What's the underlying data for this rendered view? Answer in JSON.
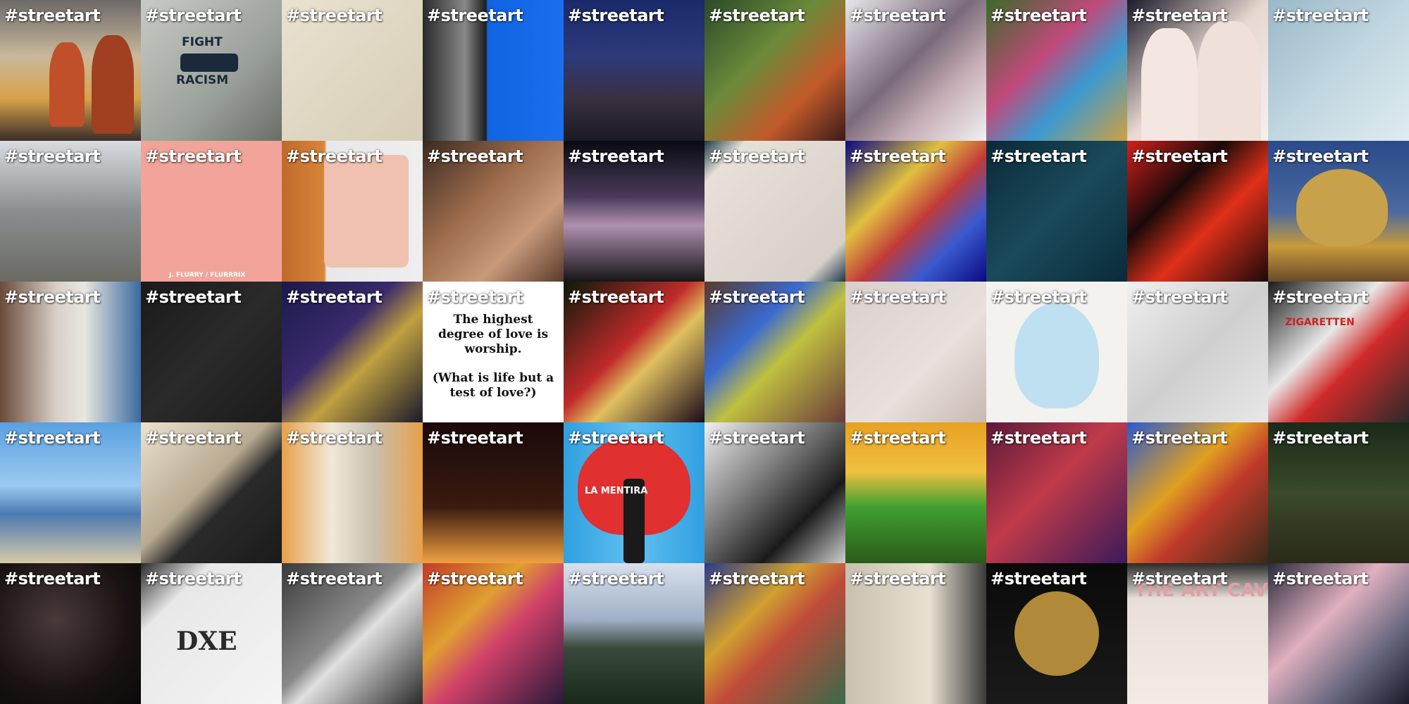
{
  "hashtag": "#streetart",
  "tiles": [
    {
      "subject": "luchador-mural",
      "bg": "linear-gradient(180deg,#6d6a6a 0%,#c9b89a 40%,#d8a24a 70%,#3a2e2a 100%)"
    },
    {
      "subject": "fight-racism-poster",
      "bg": "linear-gradient(135deg,#c8cbc4 0%,#9aa09a 60%,#6a6e68 100%)",
      "line1": "FIGHT",
      "line2": "RACISM"
    },
    {
      "subject": "ink-drawing",
      "bg": "linear-gradient(135deg,#e9e2d0 0%,#d7cdb6 100%)"
    },
    {
      "subject": "blue-sky-wall",
      "bg": "linear-gradient(90deg,#2a2a2a 0%,#888 30%,#1c1c1c 45%,#1064e0 46%,#1a6ff0 100%)"
    },
    {
      "subject": "night-street",
      "bg": "linear-gradient(180deg,#1a2a6a 0%,#2c3a7a 40%,#3a3040 70%,#1a1a22 100%)"
    },
    {
      "subject": "face-mural-green",
      "bg": "linear-gradient(135deg,#2a4a2a 0%,#6b8a3a 40%,#c25a2a 70%,#3a1a1a 100%)"
    },
    {
      "subject": "abstract-figures",
      "bg": "linear-gradient(135deg,#e8e6ec 0%,#7a6a7a 45%,#c8b0b8 70%,#f0f0f0 100%)"
    },
    {
      "subject": "colorful-face-mural",
      "bg": "linear-gradient(135deg,#3a6a2a 0%,#c04a7a 40%,#3a9ad0 65%,#d0a040 100%)"
    },
    {
      "subject": "two-girls",
      "bg": "linear-gradient(135deg,#1a1a2a 0%,#e8d8d0 50%,#f6f0f0 100%)"
    },
    {
      "subject": "heart-sketch",
      "bg": "linear-gradient(135deg,#9ab8c8 0%,#c0d6e0 50%,#e0ecf0 100%)"
    },
    {
      "subject": "city-street",
      "bg": "linear-gradient(180deg,#d8dce0 0%,#8a8e90 50%,#6a6a62 100%)"
    },
    {
      "subject": "pink-tape-art",
      "bg": "#f2a49a",
      "credit": "J. FLURRY / FLURRRIX"
    },
    {
      "subject": "frida-poster",
      "bg": "linear-gradient(90deg,#c06a2a 0%,#d8843a 30%,#e8e8ea 32%,#eeeeee 100%)"
    },
    {
      "subject": "kiss-mural",
      "bg": "linear-gradient(135deg,#3a2a22 0%,#9a6a4a 40%,#c89a7a 70%,#5a3a2a 100%)"
    },
    {
      "subject": "giant-poster-night",
      "bg": "linear-gradient(180deg,#0a0a12 0%,#4a3a5a 40%,#b090b0 60%,#151515 100%)"
    },
    {
      "subject": "ink-splatter-canvas",
      "bg": "linear-gradient(135deg,#1a3a4a 0%,#e6e0d8 15%,#d8d0c8 85%,#1a3a4a 100%)"
    },
    {
      "subject": "cubist-skull",
      "bg": "linear-gradient(135deg,#0a0a80 0%,#e0c040 35%,#c03a3a 55%,#3a5ad0 75%,#0a0a80 100%)"
    },
    {
      "subject": "framed-portraits",
      "bg": "linear-gradient(135deg,#0a2a3a 0%,#1a4a5a 50%,#0a2a3a 100%)"
    },
    {
      "subject": "red-black-graffiti",
      "bg": "linear-gradient(135deg,#d0201a 0%,#1a0a0a 35%,#e0301a 60%,#1a0a0a 100%)"
    },
    {
      "subject": "gold-skull-sculpture",
      "bg": "linear-gradient(180deg,#2a4a8a 0%,#4a6aa0 50%,#c89a3a 75%,#6a4a2a 100%)"
    },
    {
      "subject": "restroom-mural",
      "bg": "linear-gradient(90deg,#6a4a3a 0%,#d8d0c8 40%,#e8e6e0 60%,#3a6aa0 100%)"
    },
    {
      "subject": "skeleton-mural",
      "bg": "linear-gradient(135deg,#1a1a1a 0%,#2a2a2a 50%,#1a1a1a 100%)"
    },
    {
      "subject": "basquiat-wall",
      "bg": "linear-gradient(135deg,#1a1a4a 0%,#3a2a6a 40%,#c0a040 60%,#1a1a2a 100%)"
    },
    {
      "subject": "quote-card",
      "bg": "#ffffff",
      "line1": "The highest degree of love is worship.",
      "line2": "(What is life but a test of love?)"
    },
    {
      "subject": "red-demon-mural",
      "bg": "linear-gradient(135deg,#0a1a0a 0%,#c02a2a 45%,#e0c060 60%,#1a0a1a 100%)"
    },
    {
      "subject": "graffiti-alley",
      "bg": "linear-gradient(135deg,#5a3a2a 0%,#3a6ad0 35%,#c0c040 55%,#6a3a3a 100%)"
    },
    {
      "subject": "woman-drawing-wall",
      "bg": "linear-gradient(135deg,#d8d0cc 0%,#e8e0dc 60%,#c8b8b0 100%)"
    },
    {
      "subject": "blue-monster-cartoon",
      "bg": "#f4f2ee"
    },
    {
      "subject": "kissing-stencil",
      "bg": "linear-gradient(135deg,#f0f0f0 0%,#cfcfcf 50%,#e8e8e8 100%)"
    },
    {
      "subject": "vending-machine",
      "bg": "linear-gradient(135deg,#1a1a1a 0%,#e8e8e8 40%,#d02a2a 60%,#2a2a2a 100%)",
      "sign": "ZIGARETTEN"
    },
    {
      "subject": "beach-man",
      "bg": "linear-gradient(180deg,#5aa0e0 0%,#9acaf0 45%,#4a7ab0 65%,#d8c8a8 100%)"
    },
    {
      "subject": "sketching-artist",
      "bg": "linear-gradient(135deg,#eae2d0 0%,#b8aa90 45%,#2a2a2a 60%,#1a1a1a 100%)"
    },
    {
      "subject": "narrow-alley",
      "bg": "linear-gradient(90deg,#e8a04a 0%,#f0e8d8 35%,#c8c0b0 65%,#e8a04a 100%)"
    },
    {
      "subject": "night-chalk-drawing",
      "bg": "linear-gradient(180deg,#1a0a0a 0%,#3a1a10 60%,#f0a040 100%)"
    },
    {
      "subject": "heart-shutter",
      "bg": "linear-gradient(90deg,#30a0e0 0%,#60c0f0 50%,#30a0e0 100%)",
      "text": "LA MENTIRA"
    },
    {
      "subject": "bw-graffiti-wall",
      "bg": "linear-gradient(135deg,#f0f0f0 0%,#7a7a7a 40%,#1a1a1a 70%,#d0d0d0 100%)"
    },
    {
      "subject": "green-van",
      "bg": "linear-gradient(180deg,#e8a020 0%,#f0c040 35%,#40a030 60%,#2a5a1a 100%)"
    },
    {
      "subject": "neon-bar",
      "bg": "linear-gradient(135deg,#5a1a3a 0%,#c03a4a 45%,#3a1a5a 100%)"
    },
    {
      "subject": "eyes-mural",
      "bg": "linear-gradient(135deg,#2a5ad0 0%,#e0a020 40%,#c03a2a 60%,#3a2a1a 100%)"
    },
    {
      "subject": "forest-path",
      "bg": "linear-gradient(180deg,#1a2a1a 0%,#3a4a2a 50%,#2a2a1a 100%)"
    },
    {
      "subject": "bokeh-portrait",
      "bg": "radial-gradient(circle at 40% 40%,#4a3a3a 0%,#1a1212 60%,#0a0a0a 100%)"
    },
    {
      "subject": "paper-sketch",
      "bg": "linear-gradient(135deg,#2a2a2a 0%,#e8e8e8 25%,#f4f4f4 100%)",
      "text": "DXE"
    },
    {
      "subject": "stencil-astronaut",
      "bg": "linear-gradient(135deg,#3a3a3a 0%,#8a8a8a 45%,#e0e0e0 55%,#2a2a2a 100%)"
    },
    {
      "subject": "ganesha-idol",
      "bg": "linear-gradient(135deg,#c03a2a 0%,#e0a030 35%,#d0406a 55%,#2a1a3a 100%)"
    },
    {
      "subject": "landscape-view",
      "bg": "linear-gradient(180deg,#d8e0ec 0%,#a0b0c8 40%,#3a4a3a 60%,#1a2a1a 100%)"
    },
    {
      "subject": "abstract-mural",
      "bg": "linear-gradient(135deg,#2a3a8a 0%,#d0a030 35%,#c04a3a 55%,#3a6a4a 100%)"
    },
    {
      "subject": "wall-stencil-man",
      "bg": "linear-gradient(90deg,#c8c0b0 0%,#e8e0d0 60%,#3a3a3a 100%)"
    },
    {
      "subject": "pirate-skull",
      "bg": "linear-gradient(180deg,#0a0a0a 0%,#1a1a1a 100%)"
    },
    {
      "subject": "the-art-cave",
      "bg": "linear-gradient(180deg,#2a2a2a 0%,#e8e0d8 25%,#f2ece6 100%)",
      "text": "THE ART CAVE"
    },
    {
      "subject": "pink-figures",
      "bg": "linear-gradient(135deg,#2a2a3a 0%,#e0b0c0 40%,#6a6a80 70%,#1a1a2a 100%)"
    }
  ]
}
